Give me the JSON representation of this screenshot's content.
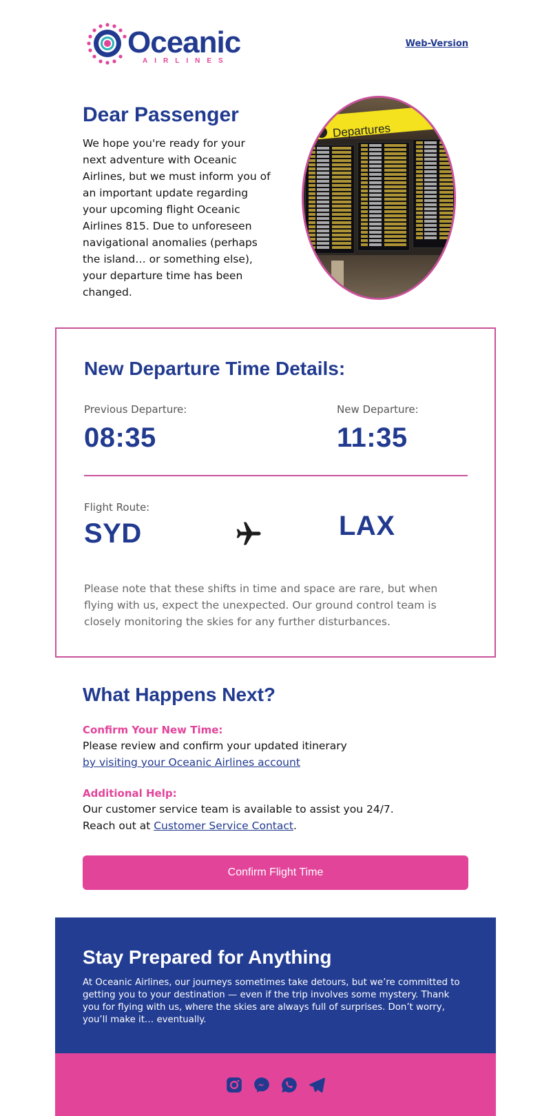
{
  "header": {
    "logo_name": "Oceanic",
    "logo_subtitle": "AIRLINES",
    "web_version_link": "Web-Version"
  },
  "intro": {
    "title": "Dear Passenger",
    "body": "We hope you're ready for your next adventure with Oceanic Airlines, but we must inform you of an important update regarding your upcoming flight Oceanic Airlines 815. Due to unforeseen navigational anomalies (perhaps the island… or something else), your departure time has been changed.",
    "image_sign_text": "Departures"
  },
  "details": {
    "title": "New Departure Time Details:",
    "previous_label": "Previous Departure:",
    "previous_time": "08:35",
    "new_label": "New Departure:",
    "new_time": "11:35",
    "route_label": "Flight Route:",
    "origin": "SYD",
    "destination": "LAX",
    "route_icon": "airplane-icon",
    "note": "Please note that these shifts in time and space are rare, but when flying with us, expect the unexpected. Our ground control team is closely monitoring the skies for any further disturbances."
  },
  "next": {
    "title": "What Happens Next?",
    "confirm_heading": "Confirm Your New Time:",
    "confirm_text": "Please review and confirm your updated itinerary",
    "confirm_link": "by visiting your Oceanic Airlines account",
    "help_heading": "Additional Help:",
    "help_text": "Our customer service team is available to assist you 24/7.",
    "help_prefix": "Reach out at ",
    "help_link": "Customer Service Contact",
    "help_suffix": ".",
    "cta_label": "Confirm Flight Time"
  },
  "footer": {
    "title": "Stay Prepared for Anything",
    "body": "At Oceanic Airlines, our journeys sometimes take detours, but we’re committed to getting you to your destination — even if the trip involves some mystery. Thank you for flying with us, where the skies are always full of surprises. Don’t worry, you’ll make it… eventually.",
    "social_icons": [
      "instagram-icon",
      "messenger-icon",
      "whatsapp-icon",
      "telegram-icon"
    ]
  },
  "colors": {
    "brand_blue": "#213a8f",
    "brand_pink": "#e2449a",
    "border_pink": "#c9529b",
    "footer_blue": "#233d92"
  }
}
